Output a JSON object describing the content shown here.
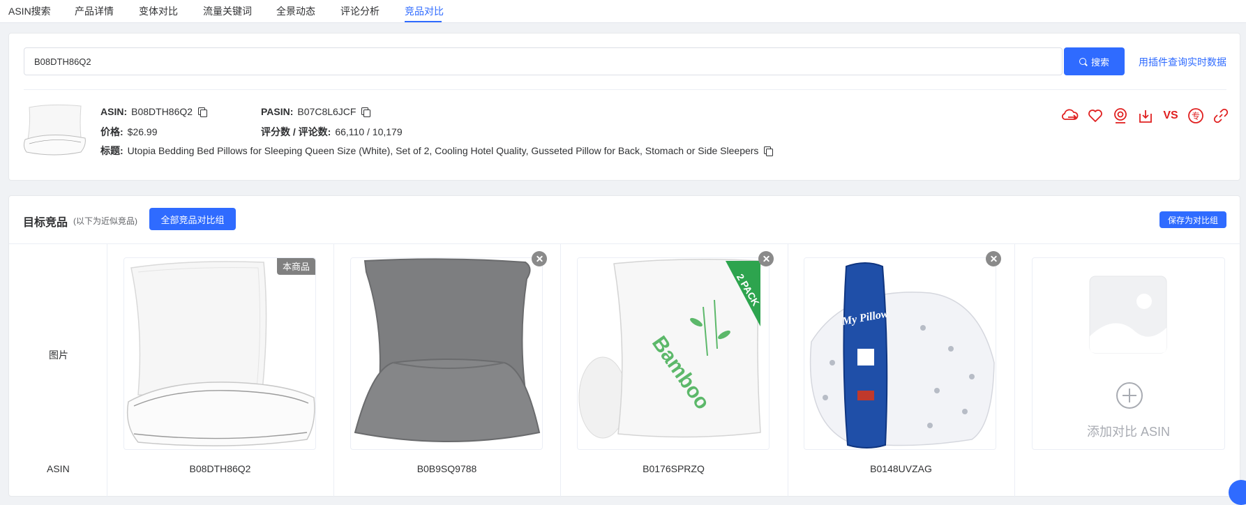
{
  "tabs": [
    {
      "label": "ASIN搜索"
    },
    {
      "label": "产品详情"
    },
    {
      "label": "变体对比"
    },
    {
      "label": "流量关键词"
    },
    {
      "label": "全景动态"
    },
    {
      "label": "评论分析"
    },
    {
      "label": "竞品对比",
      "active": true
    }
  ],
  "search": {
    "value": "B08DTH86Q2",
    "button_label": "搜索",
    "plugin_link": "用插件查询实时数据"
  },
  "product": {
    "asin_label": "ASIN:",
    "asin": "B08DTH86Q2",
    "pasin_label": "PASIN:",
    "pasin": "B07C8L6JCF",
    "price_label": "价格:",
    "price": "$26.99",
    "rating_label": "评分数 / 评论数:",
    "rating": "66,110 / 10,179",
    "title_label": "标题:",
    "title": "Utopia Bedding Bed Pillows for Sleeping Queen Size (White), Set of 2, Cooling Hotel Quality, Gusseted Pillow for Back, Stomach or Side Sleepers",
    "actions": [
      "cloud-sync-icon",
      "heart-icon",
      "webcam-icon",
      "download-icon",
      "vs-icon",
      "exclusive-icon",
      "link-icon"
    ],
    "vs_label": "VS",
    "exclusive_label": "专"
  },
  "competitors": {
    "title": "目标竞品",
    "subtitle": "(以下为近似竞品)",
    "all_button": "全部竞品对比组",
    "save_button": "保存为对比组",
    "row_image_label": "图片",
    "row_asin_label": "ASIN",
    "current_badge": "本商品",
    "add_label": "添加对比 ASIN",
    "items": [
      {
        "asin": "B08DTH86Q2",
        "current": true
      },
      {
        "asin": "B0B9SQ9788",
        "current": false
      },
      {
        "asin": "B0176SPRZQ",
        "current": false
      },
      {
        "asin": "B0148UVZAG",
        "current": false
      }
    ],
    "product_images": [
      "white-gusseted-pillows",
      "gray-pillows",
      "bamboo-pillow-2-pack",
      "my-pillow-bundle"
    ],
    "bamboo_text": "Bamboo",
    "pack_text": "2 PACK",
    "mypillow_text": "My Pillow"
  },
  "colors": {
    "accent": "#2f6bff",
    "icon_red": "#e02020"
  }
}
